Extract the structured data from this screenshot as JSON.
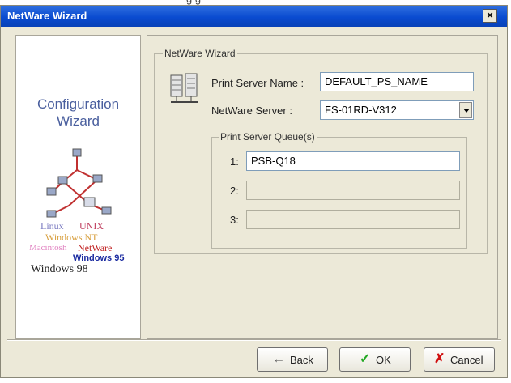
{
  "window": {
    "caption_fragment": "g         g",
    "title": "NetWare Wizard",
    "close_label": "×"
  },
  "banner": {
    "title_line1": "Configuration",
    "title_line2": "Wizard",
    "os_labels": [
      "Linux",
      "UNIX",
      "Windows NT",
      "Macintosh",
      "NetWare",
      "Windows 95",
      "Windows 98"
    ]
  },
  "group": {
    "legend": "NetWare Wizard",
    "print_server_name_label": "Print Server Name :",
    "print_server_name_value": "DEFAULT_PS_NAME",
    "netware_server_label": "NetWare Server :",
    "netware_server_value": "FS-01RD-V312",
    "queue_group": {
      "legend": "Print Server Queue(s)",
      "rows": [
        {
          "label": "1:",
          "value": "PSB-Q18"
        },
        {
          "label": "2:",
          "value": ""
        },
        {
          "label": "3:",
          "value": ""
        }
      ]
    }
  },
  "buttons": {
    "back_label": "Back",
    "ok_label": "OK",
    "cancel_label": "Cancel"
  },
  "colors": {
    "title_bar": "#0a4bd0",
    "ok_check": "#22a822",
    "cancel_x": "#d01010",
    "banner_title": "#4a5f9e"
  }
}
